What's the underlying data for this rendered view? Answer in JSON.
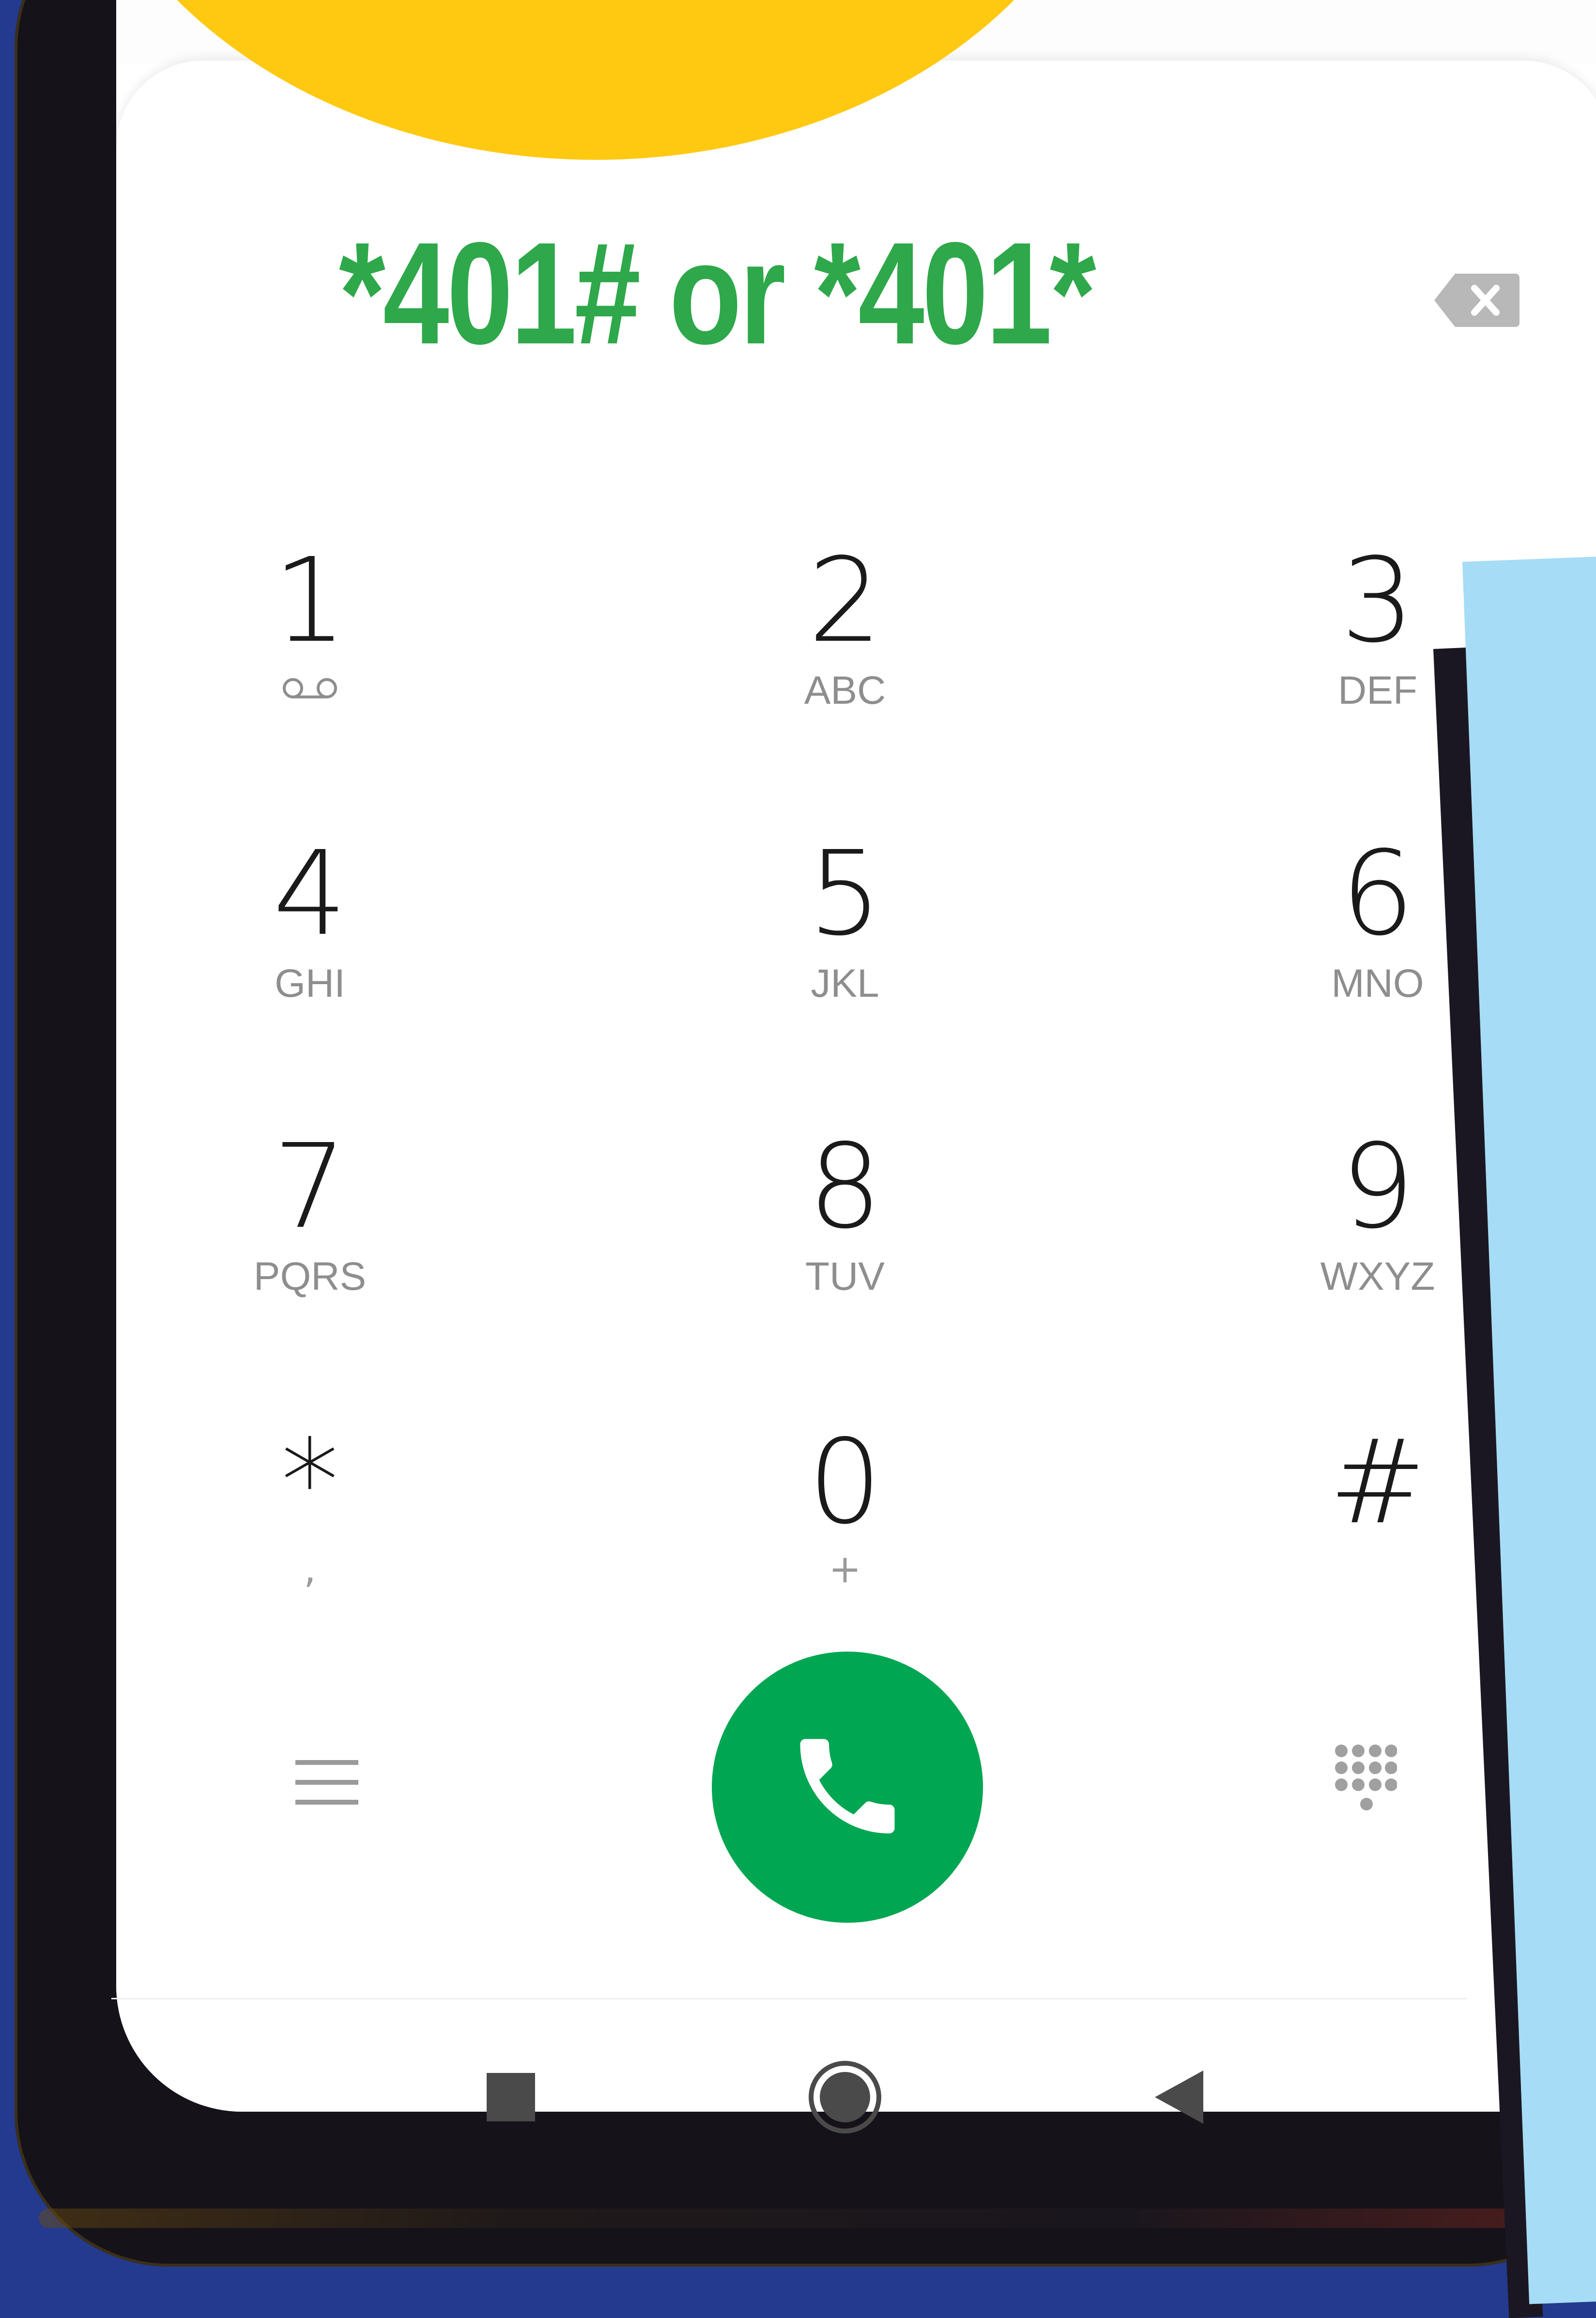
{
  "dialer": {
    "display_text": "*401# or *401*",
    "backspace_icon": "backspace-icon"
  },
  "keypad": {
    "keys": [
      {
        "digit": "1",
        "sub": "voicemail-icon"
      },
      {
        "digit": "2",
        "sub": "ABC"
      },
      {
        "digit": "3",
        "sub": "DEF"
      },
      {
        "digit": "4",
        "sub": "GHI"
      },
      {
        "digit": "5",
        "sub": "JKL"
      },
      {
        "digit": "6",
        "sub": "MNO"
      },
      {
        "digit": "7",
        "sub": "PQRS"
      },
      {
        "digit": "8",
        "sub": "TUV"
      },
      {
        "digit": "9",
        "sub": "WXYZ"
      },
      {
        "digit": "*",
        "sub": ","
      },
      {
        "digit": "0",
        "sub": "+"
      },
      {
        "digit": "#",
        "sub": ""
      }
    ]
  },
  "controls": {
    "menu_icon": "menu-icon",
    "call_icon": "phone-icon",
    "dialpad_icon": "dialpad-icon"
  },
  "navigation": {
    "recents_icon": "square-icon",
    "home_icon": "home-circle-icon",
    "back_icon": "back-triangle-icon"
  },
  "colors": {
    "background": "#233a8e",
    "accent_yellow": "#ffc912",
    "accent_blue": "#a6dcf5",
    "dial_text": "#2ea84a",
    "call_button": "#00a651"
  }
}
